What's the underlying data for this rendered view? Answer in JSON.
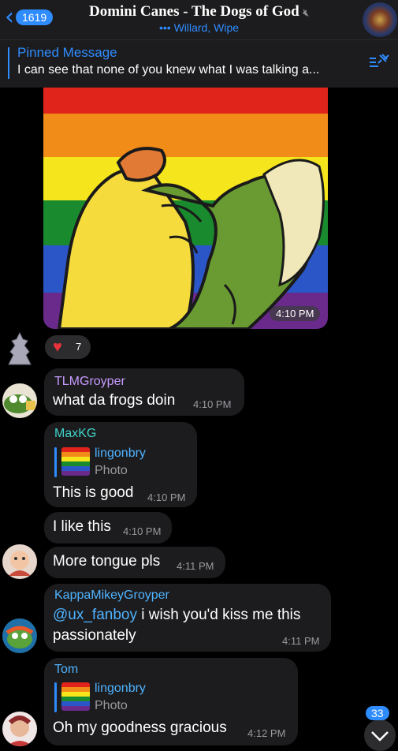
{
  "header": {
    "back_count": "1619",
    "title": "Domini Canes - The Dogs of God",
    "subtitle": "Willard, Wipe",
    "typing_dots": "•••"
  },
  "pinned": {
    "title": "Pinned Message",
    "text": "I can see that none of you knew what I was talking a..."
  },
  "photo": {
    "time": "4:10 PM"
  },
  "reaction": {
    "emoji": "♥",
    "count": "7"
  },
  "messages": [
    {
      "sender": "TLMGroyper",
      "sender_color": "#c79bff",
      "text": "what da frogs doin",
      "time": "4:10 PM"
    },
    {
      "sender": "MaxKG",
      "sender_color": "#3fd3c8",
      "reply_name": "lingonbry",
      "reply_sub": "Photo",
      "text": "This is good",
      "time": "4:10 PM"
    },
    {
      "text": "I like this",
      "time": "4:10 PM"
    },
    {
      "text": "More tongue pls",
      "time": "4:11 PM"
    },
    {
      "sender": "KappaMikeyGroyper",
      "sender_color": "#4fb3ff",
      "mention": "@ux_fanboy",
      "text_line1": " i wish you'd kiss me this",
      "text_line2": "passionately",
      "time": "4:11 PM"
    },
    {
      "sender": "Tom",
      "sender_color": "#4fb3ff",
      "reply_name": "lingonbry",
      "reply_sub": "Photo",
      "text": "Oh my goodness gracious",
      "time": "4:12 PM"
    }
  ],
  "scroll": {
    "unread": "33"
  },
  "colors": {
    "accent": "#2f8cff",
    "bubble": "#1c1c1e",
    "heart": "#e8323c"
  }
}
